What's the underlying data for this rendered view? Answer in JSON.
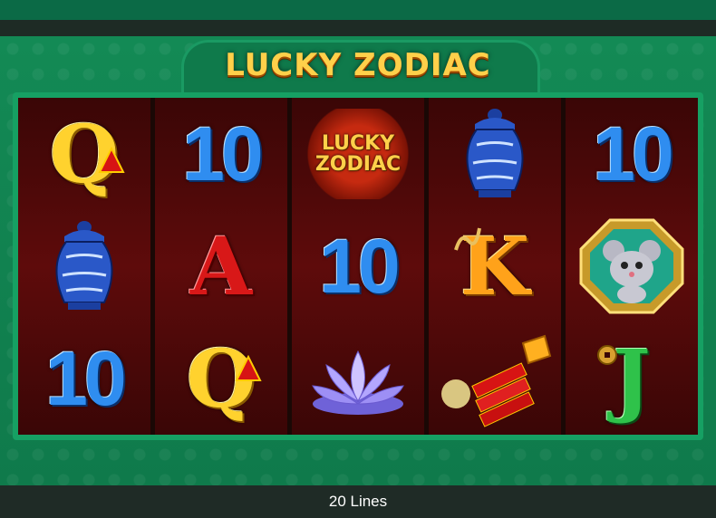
{
  "game": {
    "title": "LUCKY ZODIAC",
    "wild_line1": "LUCKY",
    "wild_line2": "ZODIAC"
  },
  "reels": [
    [
      "Q",
      "vase-icon",
      "10"
    ],
    [
      "10",
      "A",
      "Q"
    ],
    [
      "wild-logo",
      "10",
      "lotus-icon"
    ],
    [
      "vase-icon",
      "K",
      "firecracker-icon"
    ],
    [
      "10",
      "rat-icon",
      "J"
    ]
  ],
  "status": {
    "lines_label": "20 Lines"
  },
  "colors": {
    "felt": "#0f7a4b",
    "reel_bg": "#5e0b0b",
    "gold": "#ffd22e",
    "blue": "#2f8df0"
  }
}
